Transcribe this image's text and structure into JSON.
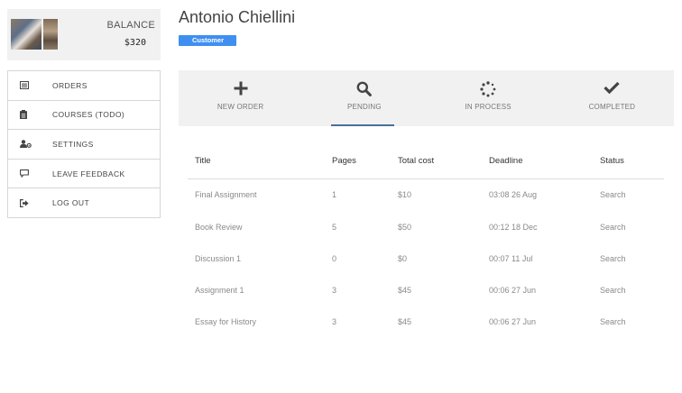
{
  "balance": {
    "label": "BALANCE",
    "amount": "$320"
  },
  "user": {
    "name": "Antonio Chiellini",
    "role": "Customer"
  },
  "sidebar": {
    "items": [
      {
        "label": "ORDERS",
        "icon": "list-icon"
      },
      {
        "label": "COURSES (TODO)",
        "icon": "clipboard-icon"
      },
      {
        "label": "SETTINGS",
        "icon": "user-gear-icon"
      },
      {
        "label": "LEAVE FEEDBACK",
        "icon": "comment-icon"
      },
      {
        "label": "LOG OUT",
        "icon": "sign-out-icon"
      }
    ]
  },
  "tabs": [
    {
      "label": "NEW ORDER",
      "icon": "plus-icon"
    },
    {
      "label": "PENDING",
      "icon": "search-icon",
      "active": true
    },
    {
      "label": "IN PROCESS",
      "icon": "spinner-icon"
    },
    {
      "label": "COMPLETED",
      "icon": "check-icon"
    }
  ],
  "table": {
    "headers": {
      "title": "Title",
      "pages": "Pages",
      "cost": "Total cost",
      "deadline": "Deadline",
      "status": "Status"
    },
    "rows": [
      {
        "title": "Final Assignment",
        "pages": "1",
        "cost": "$10",
        "deadline": "03:08 26 Aug",
        "status": "Search"
      },
      {
        "title": "Book Review",
        "pages": "5",
        "cost": "$50",
        "deadline": "00:12 18 Dec",
        "status": "Search"
      },
      {
        "title": "Discussion 1",
        "pages": "0",
        "cost": "$0",
        "deadline": "00:07 11 Jul",
        "status": "Search"
      },
      {
        "title": "Assignment 1",
        "pages": "3",
        "cost": "$45",
        "deadline": "00:06 27 Jun",
        "status": "Search"
      },
      {
        "title": "Essay for History",
        "pages": "3",
        "cost": "$45",
        "deadline": "00:06 27 Jun",
        "status": "Search"
      }
    ]
  },
  "colors": {
    "badge": "#3f8ff0",
    "active_tab_underline": "#4a6f96",
    "panel_bg": "#f1f1f1"
  }
}
